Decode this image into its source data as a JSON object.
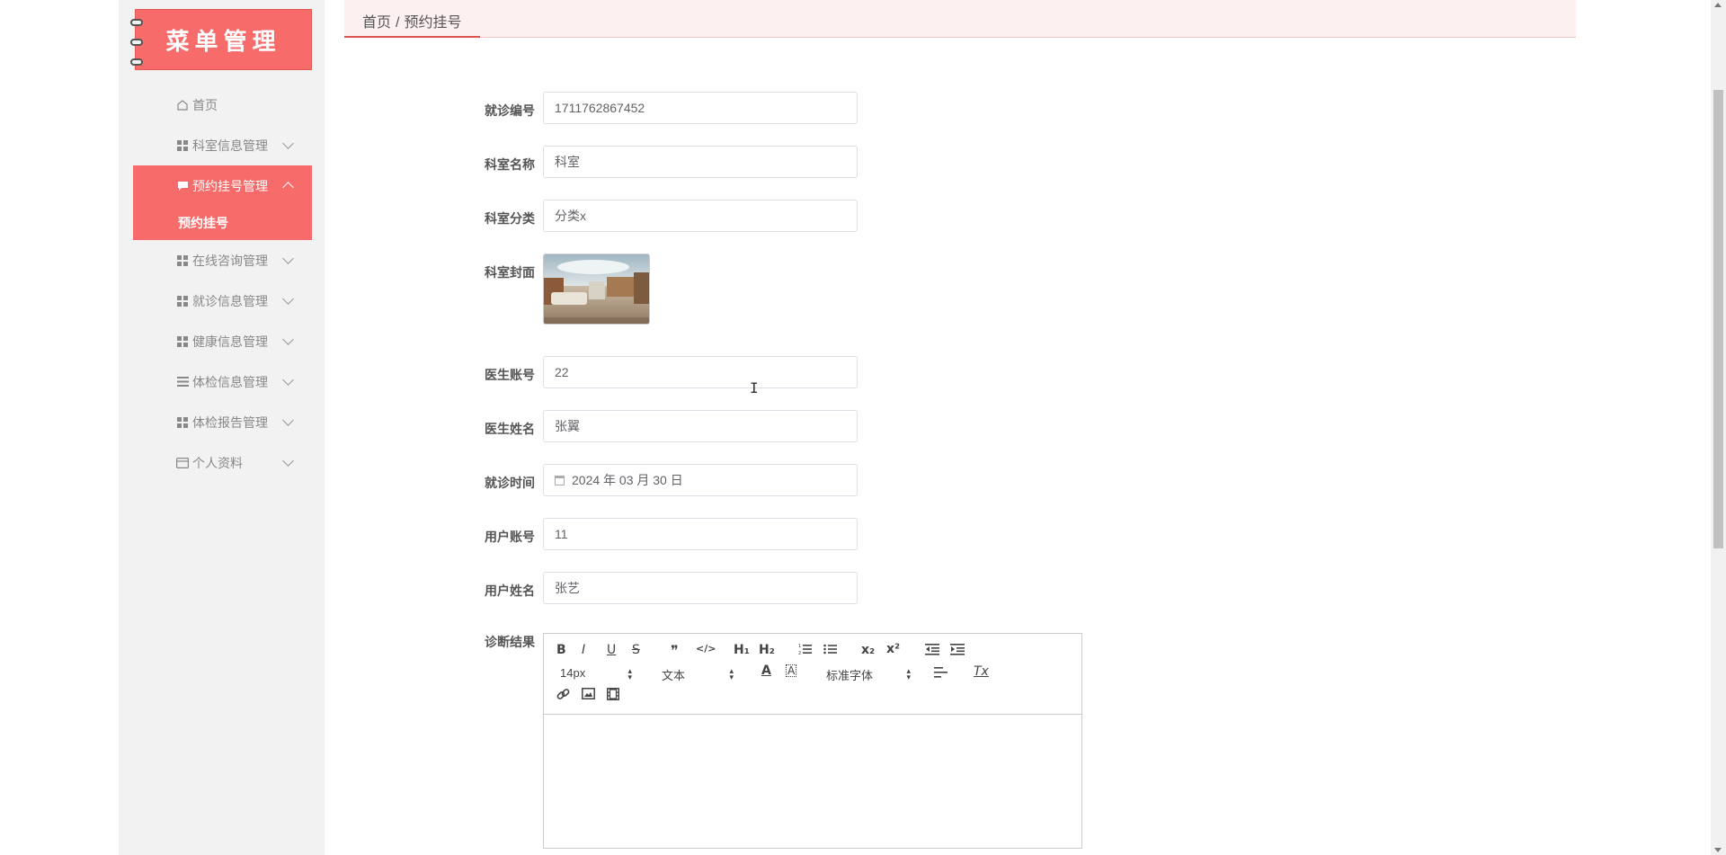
{
  "sidebar": {
    "logo_text": "菜单管理",
    "items": [
      {
        "label": "首页",
        "icon": "home-icon"
      },
      {
        "label": "科室信息管理",
        "icon": "grid-icon"
      },
      {
        "label": "预约挂号管理",
        "icon": "chat-icon",
        "active": true
      },
      {
        "label": "在线咨询管理",
        "icon": "grid-icon"
      },
      {
        "label": "就诊信息管理",
        "icon": "grid-icon"
      },
      {
        "label": "健康信息管理",
        "icon": "grid-icon"
      },
      {
        "label": "体检信息管理",
        "icon": "list-icon"
      },
      {
        "label": "体检报告管理",
        "icon": "grid-icon"
      },
      {
        "label": "个人资料",
        "icon": "card-icon"
      }
    ],
    "submenu_active": "预约挂号"
  },
  "breadcrumb": {
    "home": "首页",
    "separator": "/",
    "current": "预约挂号"
  },
  "form": {
    "visit_no": {
      "label": "就诊编号",
      "value": "1711762867452"
    },
    "dept_name": {
      "label": "科室名称",
      "value": "科室"
    },
    "dept_category": {
      "label": "科室分类",
      "value": "分类x"
    },
    "dept_cover": {
      "label": "科室封面"
    },
    "doctor_account": {
      "label": "医生账号",
      "value": "22"
    },
    "doctor_name": {
      "label": "医生姓名",
      "value": "张翼"
    },
    "visit_time": {
      "label": "就诊时间",
      "value": "2024 年 03 月 30 日"
    },
    "user_account": {
      "label": "用户账号",
      "value": "11"
    },
    "user_name": {
      "label": "用户姓名",
      "value": "张艺"
    },
    "diagnosis": {
      "label": "诊断结果"
    }
  },
  "editor": {
    "font_size": "14px",
    "header_type": "文本",
    "font_family": "标准字体",
    "buttons": {
      "bold": "B",
      "italic": "I",
      "underline": "U",
      "strike": "S",
      "quote": "❞",
      "code": "</>",
      "h1": "H₁",
      "h2": "H₂",
      "subscript": "x₂",
      "superscript": "x²",
      "text_color": "A",
      "bg_color": "A",
      "clean": "Tx"
    }
  },
  "colors": {
    "accent": "#f76b6b",
    "breadcrumb_bg": "#fdf0f0",
    "sidebar_bg": "#f2f2f2"
  }
}
